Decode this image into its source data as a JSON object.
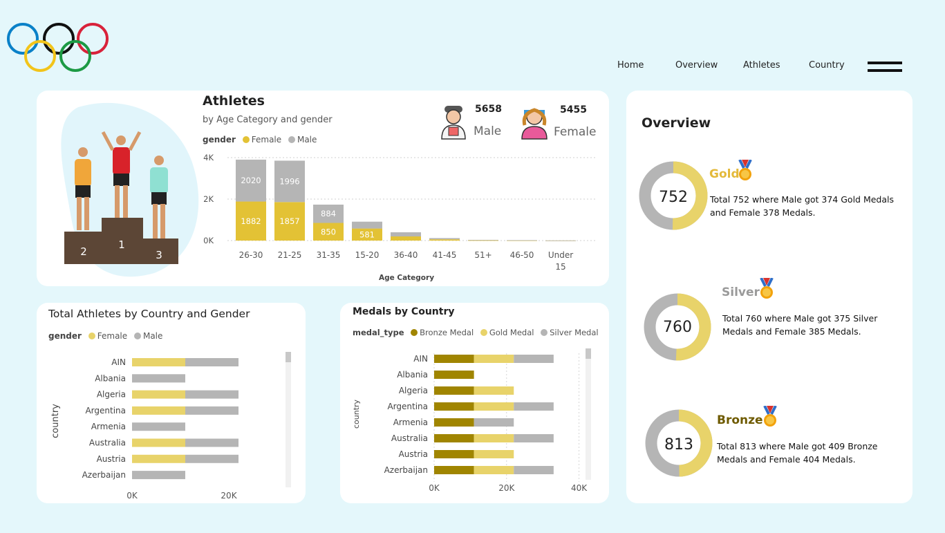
{
  "nav": {
    "items": [
      "Home",
      "Overview",
      "Athletes",
      "Country"
    ]
  },
  "colors": {
    "female": "#e3c235",
    "male": "#b5b5b5",
    "bronze": "#a08500",
    "gold": "#e8d36a",
    "silver": "#b5b5b5",
    "bg": "#e4f7fb"
  },
  "athletes_card": {
    "title": "Athletes",
    "subtitle": "by Age Category and gender",
    "legend_title": "gender",
    "legend_female": "Female",
    "legend_male": "Male",
    "male_count": "5658",
    "male_label": "Male",
    "female_count": "5455",
    "female_label": "Female",
    "xlabel": "Age Category",
    "podium": [
      "2",
      "1",
      "3"
    ]
  },
  "country_card": {
    "title": "Total Athletes by Country and Gender",
    "legend_title": "gender",
    "legend_female": "Female",
    "legend_male": "Male",
    "ylabel": "country"
  },
  "medals_card": {
    "title": "Medals by Country",
    "legend_title": "medal_type",
    "legend_bronze": "Bronze Medal",
    "legend_gold": "Gold Medal",
    "legend_silver": "Silver Medal",
    "ylabel": "country"
  },
  "overview": {
    "title": "Overview",
    "medals": [
      {
        "name": "Gold",
        "total": "752",
        "desc": "Total 752 where Male got 374 Gold Medals and Female 378 Medals.",
        "male": 374,
        "female": 378,
        "color": "#e3b93a"
      },
      {
        "name": "Silver",
        "total": "760",
        "desc": "Total 760 where Male got 375 Silver Medals and Female 385 Medals.",
        "male": 375,
        "female": 385,
        "color": "#9a9a9a"
      },
      {
        "name": "Bronze",
        "total": "813",
        "desc": "Total 813 where Male got 409 Bronze Medals and Female 404 Medals.",
        "male": 409,
        "female": 404,
        "color": "#6e5a00"
      }
    ]
  },
  "chart_data": [
    {
      "type": "bar",
      "stacked": true,
      "title": "Athletes",
      "subtitle": "by Age Category and gender",
      "xlabel": "Age Category",
      "categories": [
        "26-30",
        "21-25",
        "31-35",
        "15-20",
        "36-40",
        "41-45",
        "51+",
        "46-50",
        "Under 15"
      ],
      "series": [
        {
          "name": "Female",
          "values": [
            1882,
            1857,
            850,
            581,
            200,
            60,
            15,
            10,
            3
          ],
          "labels": [
            "1882",
            "1857",
            "850",
            "581",
            "",
            "",
            "",
            "",
            ""
          ]
        },
        {
          "name": "Male",
          "values": [
            2020,
            1996,
            884,
            330,
            200,
            60,
            20,
            12,
            4
          ],
          "labels": [
            "2020",
            "1996",
            "884",
            "",
            "",
            "",
            "",
            "",
            ""
          ]
        }
      ],
      "yticks": [
        "0K",
        "2K",
        "4K"
      ],
      "ylim": [
        0,
        4000
      ],
      "grid": true,
      "legend": "top-left"
    },
    {
      "type": "bar",
      "orientation": "horizontal",
      "stacked": true,
      "title": "Total Athletes by Country and Gender",
      "ylabel": "country",
      "categories": [
        "AIN",
        "Albania",
        "Algeria",
        "Argentina",
        "Armenia",
        "Australia",
        "Austria",
        "Azerbaijan"
      ],
      "series": [
        {
          "name": "Female",
          "values": [
            11000,
            0,
            11000,
            11000,
            0,
            11000,
            11000,
            0
          ]
        },
        {
          "name": "Male",
          "values": [
            11000,
            11000,
            11000,
            11000,
            11000,
            11000,
            11000,
            11000
          ]
        }
      ],
      "xticks": [
        "0K",
        "20K"
      ],
      "xlim": [
        0,
        30000
      ],
      "legend": "top-left"
    },
    {
      "type": "bar",
      "orientation": "horizontal",
      "stacked": true,
      "title": "Medals by Country",
      "ylabel": "country",
      "categories": [
        "AIN",
        "Albania",
        "Algeria",
        "Argentina",
        "Armenia",
        "Australia",
        "Austria",
        "Azerbaijan"
      ],
      "series": [
        {
          "name": "Bronze Medal",
          "values": [
            11000,
            11000,
            11000,
            11000,
            11000,
            11000,
            11000,
            11000
          ]
        },
        {
          "name": "Gold Medal",
          "values": [
            11000,
            0,
            11000,
            11000,
            0,
            11000,
            11000,
            11000
          ]
        },
        {
          "name": "Silver Medal",
          "values": [
            11000,
            0,
            0,
            11000,
            11000,
            11000,
            0,
            11000
          ]
        }
      ],
      "xticks": [
        "0K",
        "20K",
        "40K"
      ],
      "xlim": [
        0,
        42000
      ],
      "grid": true,
      "legend": "top-left"
    }
  ]
}
